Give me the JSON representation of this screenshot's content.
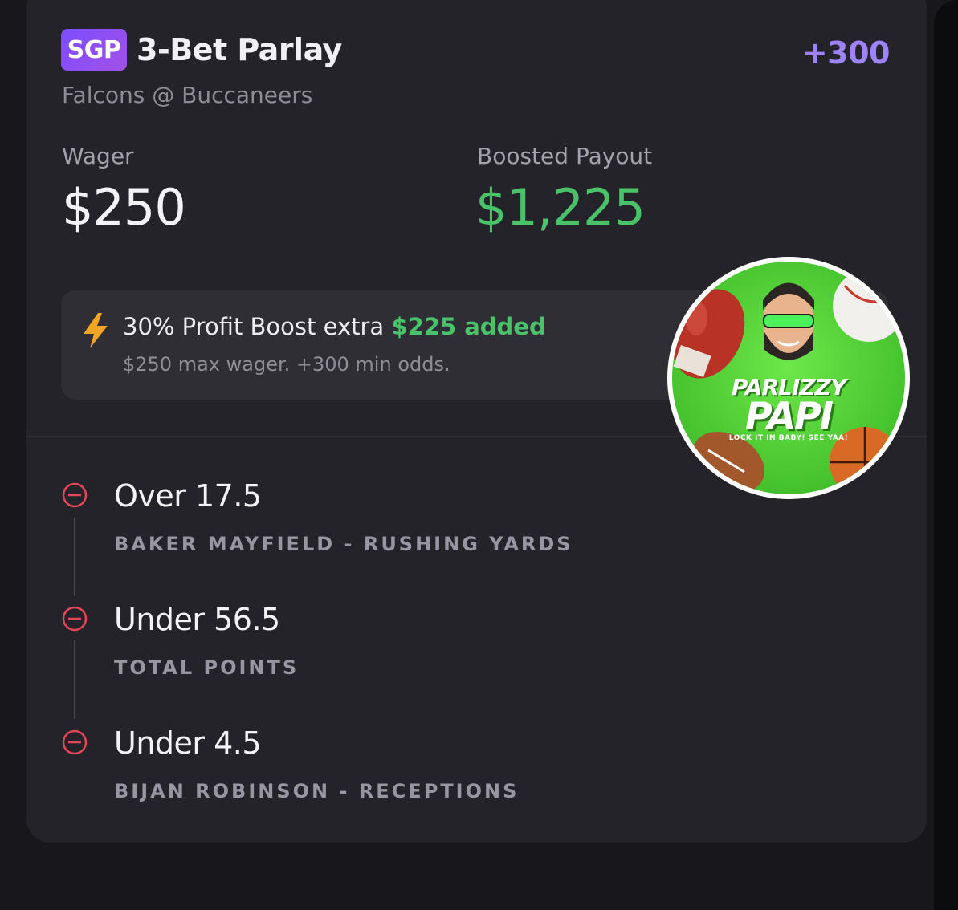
{
  "bet": {
    "badge": "SGP",
    "title": "3-Bet Parlay",
    "odds": "+300",
    "matchup": "Falcons @ Buccaneers"
  },
  "wager": {
    "label": "Wager",
    "amount": "$250"
  },
  "payout": {
    "label": "Boosted Payout",
    "amount": "$1,225"
  },
  "boost": {
    "icon": "lightning-bolt-icon",
    "main": "30% Profit Boost extra",
    "added": "$225 added",
    "sub": "$250 max wager. +300 min odds."
  },
  "legs": [
    {
      "pick": "Over 17.5",
      "market": "BAKER MAYFIELD - RUSHING YARDS",
      "icon": "minus-circle-icon"
    },
    {
      "pick": "Under 56.5",
      "market": "TOTAL POINTS",
      "icon": "minus-circle-icon"
    },
    {
      "pick": "Under 4.5",
      "market": "BIJAN ROBINSON - RECEPTIONS",
      "icon": "minus-circle-icon"
    }
  ],
  "avatar": {
    "name_line1": "PARLIZZY",
    "name_line2": "PAPI",
    "tagline": "LOCK IT IN BABY! SEE YAA!"
  },
  "colors": {
    "accent_purple": "#9d83f7",
    "payout_green": "#49c26a",
    "leg_red": "#e5475a",
    "card_bg": "#242329"
  }
}
